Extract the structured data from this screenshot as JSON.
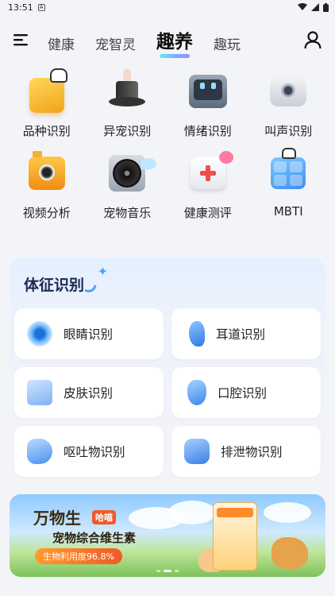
{
  "status": {
    "time": "13:51",
    "sim_glyph": "A"
  },
  "nav": {
    "tabs": [
      {
        "label": "健康"
      },
      {
        "label": "宠智灵"
      },
      {
        "label": "趣养"
      },
      {
        "label": "趣玩"
      }
    ],
    "active_tab": "趣养",
    "accent_gradient": [
      "#6fe3ff",
      "#7aa7ff",
      "#9c8cff"
    ]
  },
  "features": [
    {
      "label": "品种识别",
      "icon": "breed-box-icon"
    },
    {
      "label": "异宠识别",
      "icon": "magic-hat-icon"
    },
    {
      "label": "情绪识别",
      "icon": "monitor-face-icon"
    },
    {
      "label": "叫声识别",
      "icon": "speaker-icon"
    },
    {
      "label": "视频分析",
      "icon": "camera-icon"
    },
    {
      "label": "宠物音乐",
      "icon": "record-player-icon"
    },
    {
      "label": "健康测评",
      "icon": "medical-kit-icon"
    },
    {
      "label": "MBTI",
      "icon": "mbti-cat-icon"
    }
  ],
  "body_section": {
    "title": "体征识别",
    "items": [
      {
        "label": "眼睛识别",
        "icon": "eye-icon"
      },
      {
        "label": "耳道识别",
        "icon": "ear-icon"
      },
      {
        "label": "皮肤识别",
        "icon": "skin-icon"
      },
      {
        "label": "口腔识别",
        "icon": "tooth-icon"
      },
      {
        "label": "呕吐物识别",
        "icon": "stomach-icon"
      },
      {
        "label": "排泄物识别",
        "icon": "intestine-icon"
      }
    ]
  },
  "banner": {
    "title": "万物生",
    "brand": "哈喵",
    "subtitle": "宠物综合维生素",
    "badge": "生物利用度96.8%",
    "page_count": 3,
    "active_page": 1
  }
}
